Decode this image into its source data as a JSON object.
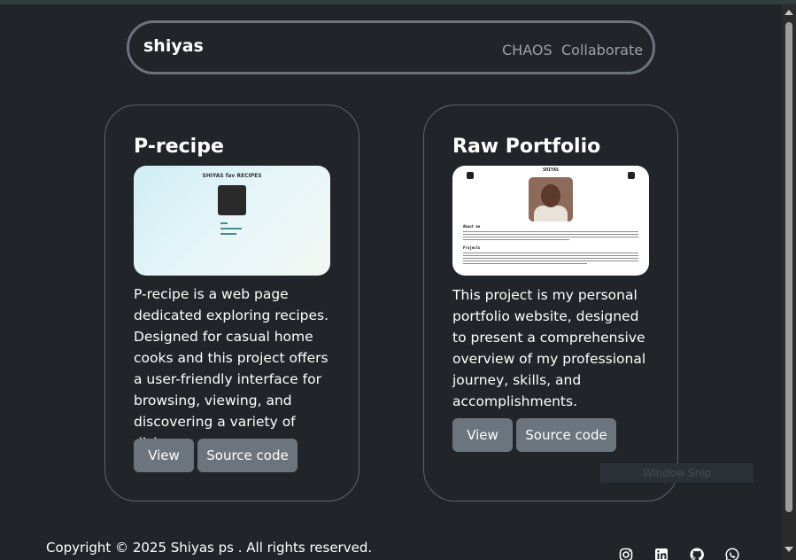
{
  "navbar": {
    "brand": "shiyas",
    "links": [
      "CHAOS",
      "Collaborate"
    ]
  },
  "projects": [
    {
      "title": "P-recipe",
      "thumbnail_caption": "SHIYAS fav RECIPES",
      "description": "P-recipe is a web page dedicated exploring recipes. Designed for casual home cooks and this project offers a user-friendly interface for browsing, viewing, and discovering a variety of dishes.",
      "view_label": "View",
      "source_label": "Source code"
    },
    {
      "title": "Raw Portfolio",
      "thumbnail_caption": "SHIYAS",
      "thumbnail_sections": [
        "About me",
        "Projects"
      ],
      "description": "This project is my personal portfolio website, designed to present a comprehensive overview of my professional journey, skills, and accomplishments.",
      "view_label": "View",
      "source_label": "Source code"
    }
  ],
  "overlay": {
    "label": "Window Snip"
  },
  "footer": {
    "copyright": "Copyright © 2025 Shiyas ps . All rights reserved.",
    "social_icons": [
      "instagram-icon",
      "linkedin-icon",
      "github-icon",
      "whatsapp-icon"
    ]
  },
  "colors": {
    "background": "#212529",
    "button": "#6c757d",
    "nav_border": "#6c737a",
    "nav_link": "#9ba1a7"
  }
}
